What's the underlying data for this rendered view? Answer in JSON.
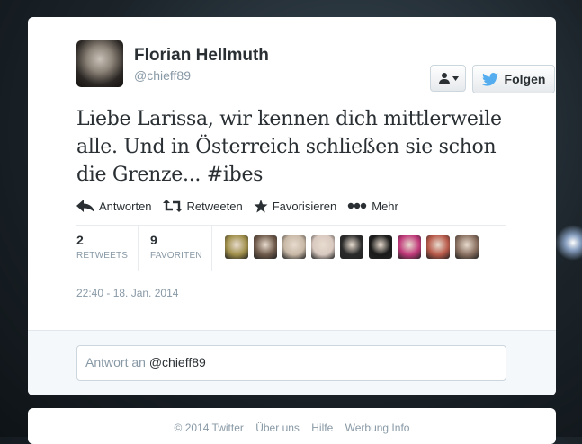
{
  "colors": {
    "twitter_blue": "#55acee",
    "accent": "#292f33",
    "muted": "#8899a6"
  },
  "tweet": {
    "author_name": "Florian Hellmuth",
    "author_handle": "@chieff89",
    "follow_button": "Folgen",
    "text_line1": "Liebe Larissa, wir kennen dich mittlerweile",
    "text_line2": "alle. Und in Österreich schließen sie schon",
    "text_line3_prefix": "die Grenze... ",
    "hashtag": "#ibes",
    "actions": {
      "reply": "Antworten",
      "retweet": "Retweeten",
      "favorite": "Favorisieren",
      "more": "Mehr"
    },
    "stats": {
      "retweets_count": "2",
      "retweets_label": "RETWEETS",
      "favorites_count": "9",
      "favorites_label": "FAVORITEN"
    },
    "favoriters": [
      {
        "name": "favoriter-1",
        "color": "#a08f4a"
      },
      {
        "name": "favoriter-2",
        "color": "#6f5a4a"
      },
      {
        "name": "favoriter-3",
        "color": "#c8b8a6"
      },
      {
        "name": "favoriter-4",
        "color": "#d9c9c0"
      },
      {
        "name": "favoriter-5",
        "color": "#2a2a2a"
      },
      {
        "name": "favoriter-6",
        "color": "#1a1a1a"
      },
      {
        "name": "favoriter-7",
        "color": "#c0397a"
      },
      {
        "name": "favoriter-8",
        "color": "#b85a4a"
      },
      {
        "name": "favoriter-9",
        "color": "#8a7060"
      }
    ],
    "timestamp": "22:40 - 18. Jan. 2014"
  },
  "reply": {
    "placeholder": "Antwort an",
    "handle": "@chieff89"
  },
  "footer": {
    "copyright": "© 2014 Twitter",
    "about": "Über uns",
    "help": "Hilfe",
    "ads": "Werbung Info"
  }
}
